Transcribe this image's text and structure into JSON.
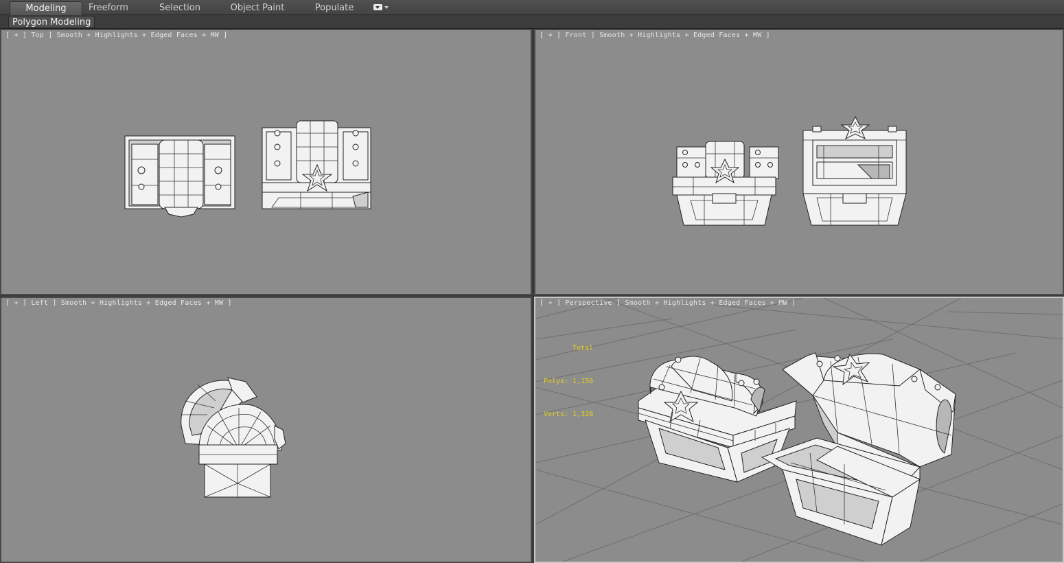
{
  "ribbon": {
    "tabs": [
      "Modeling",
      "Freeform",
      "Selection",
      "Object Paint",
      "Populate"
    ],
    "active_tab": "Modeling",
    "sub_panel": "Polygon Modeling"
  },
  "viewports": {
    "top": {
      "label": "[ + ] Top ] Smooth + Highlights + Edged Faces + MW ]"
    },
    "front": {
      "label": "[ + ] Front ] Smooth + Highlights + Edged Faces + MW ]"
    },
    "left": {
      "label": "[ + ] Left ] Smooth + Highlights + Edged Faces + MW ]"
    },
    "perspective": {
      "label": "[ + ] Perspective ] Smooth + Highlights + Edged Faces + MW ]",
      "stats": {
        "title": "Total",
        "polys": "Polys: 1,156",
        "verts": "Verts: 1,328"
      }
    }
  },
  "colors": {
    "viewport_bg": "#8c8c8c",
    "stats_text": "#e8d418",
    "active_border": "#c8c8c8"
  }
}
